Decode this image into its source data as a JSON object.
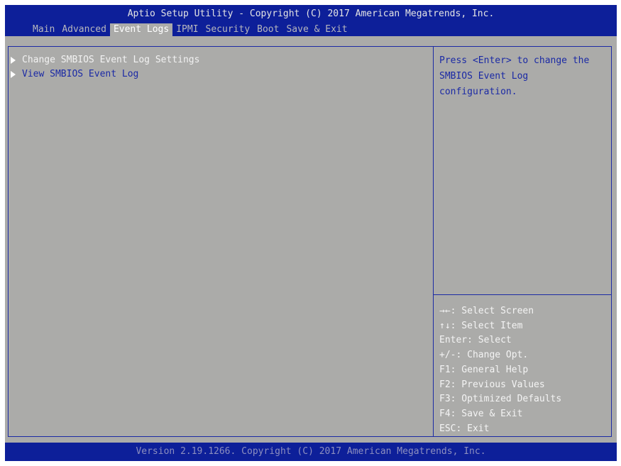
{
  "header": {
    "title": "Aptio Setup Utility - Copyright (C) 2017 American Megatrends, Inc."
  },
  "tabs": [
    {
      "label": "Main"
    },
    {
      "label": "Advanced"
    },
    {
      "label": "Event Logs"
    },
    {
      "label": "IPMI"
    },
    {
      "label": "Security"
    },
    {
      "label": "Boot"
    },
    {
      "label": "Save & Exit"
    }
  ],
  "active_tab": "Event Logs",
  "menu": {
    "items": [
      {
        "label": "Change SMBIOS Event Log Settings"
      },
      {
        "label": "View SMBIOS Event Log"
      }
    ]
  },
  "help": {
    "lines": [
      "Press <Enter> to change the",
      "SMBIOS Event Log",
      "configuration."
    ]
  },
  "keys": [
    "→←: Select Screen",
    "↑↓: Select Item",
    "Enter: Select",
    "+/-: Change Opt.",
    "F1: General Help",
    "F2: Previous Values",
    "F3: Optimized Defaults",
    "F4: Save & Exit",
    "ESC: Exit"
  ],
  "footer": {
    "text": "Version 2.19.1266. Copyright (C) 2017 American Megatrends, Inc."
  },
  "colors": {
    "bios_blue": "#0d1f99",
    "panel_gray": "#ababa9",
    "text_blue": "#1b2aa5"
  }
}
